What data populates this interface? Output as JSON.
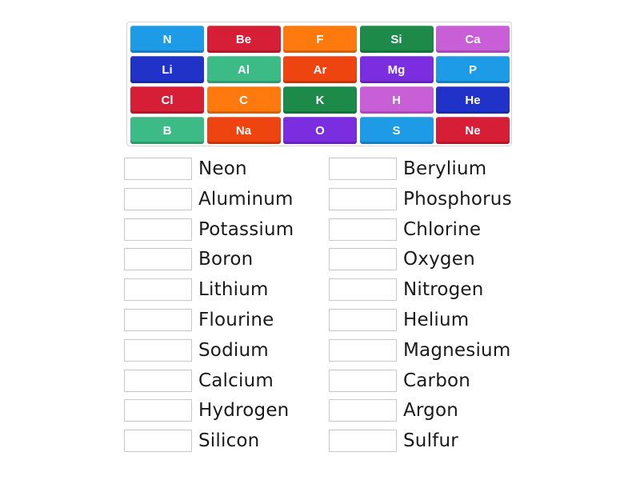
{
  "tiles": [
    {
      "label": "N",
      "color": "#1e9be6"
    },
    {
      "label": "Be",
      "color": "#d61f36"
    },
    {
      "label": "F",
      "color": "#ff7a0e"
    },
    {
      "label": "Si",
      "color": "#1d8a4a"
    },
    {
      "label": "Ca",
      "color": "#c95fd6"
    },
    {
      "label": "Li",
      "color": "#2032c8"
    },
    {
      "label": "Al",
      "color": "#3dbb86"
    },
    {
      "label": "Ar",
      "color": "#ee4410"
    },
    {
      "label": "Mg",
      "color": "#7a2ee0"
    },
    {
      "label": "P",
      "color": "#1e9be6"
    },
    {
      "label": "Cl",
      "color": "#d61f36"
    },
    {
      "label": "C",
      "color": "#ff7a0e"
    },
    {
      "label": "K",
      "color": "#1d8a4a"
    },
    {
      "label": "H",
      "color": "#c95fd6"
    },
    {
      "label": "He",
      "color": "#2032c8"
    },
    {
      "label": "B",
      "color": "#3dbb86"
    },
    {
      "label": "Na",
      "color": "#ee4410"
    },
    {
      "label": "O",
      "color": "#7a2ee0"
    },
    {
      "label": "S",
      "color": "#1e9be6"
    },
    {
      "label": "Ne",
      "color": "#d61f36"
    }
  ],
  "left_items": [
    "Neon",
    "Aluminum",
    "Potassium",
    "Boron",
    "Lithium",
    "Flourine",
    "Sodium",
    "Calcium",
    "Hydrogen",
    "Silicon"
  ],
  "right_items": [
    "Berylium",
    "Phosphorus",
    "Chlorine",
    "Oxygen",
    "Nitrogen",
    "Helium",
    "Magnesium",
    "Carbon",
    "Argon",
    "Sulfur"
  ]
}
